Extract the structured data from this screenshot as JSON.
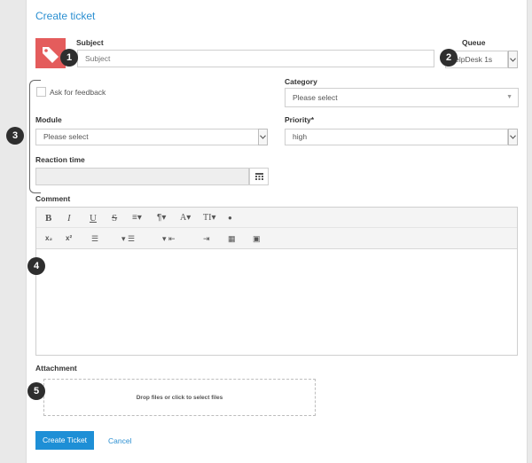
{
  "form": {
    "title": "Create ticket",
    "subject": {
      "label": "Subject",
      "placeholder": "Subject",
      "badge": "1"
    },
    "queue": {
      "label": "Queue",
      "value": "HelpDesk 1s",
      "badge": "2"
    },
    "ask_feedback": {
      "label": "Ask for feedback",
      "checked": false
    },
    "category": {
      "label": "Category",
      "value": "Please select"
    },
    "module": {
      "label": "Module",
      "value": "Please select"
    },
    "priority": {
      "label": "Priority*",
      "value": "high"
    },
    "reaction_time": {
      "label": "Reaction time",
      "value": ""
    },
    "group_badge": "3",
    "comment": {
      "label": "Comment",
      "badge": "4",
      "toolbar_row1": [
        "B",
        "I",
        "U",
        "S",
        "≡▾",
        "¶▾",
        "A▾",
        "TI▾",
        "●"
      ],
      "toolbar_row2": [
        "x₂",
        "x²",
        "☰",
        "▾ ☰",
        "▾ ⇤",
        "⇥",
        "▦",
        "▣"
      ]
    },
    "attachment": {
      "label": "Attachment",
      "drop_text": "Drop files or click to select files",
      "badge": "5"
    },
    "actions": {
      "create": "Create Ticket",
      "cancel": "Cancel"
    }
  },
  "colors": {
    "accent": "#1e8fd6",
    "tag_icon_bg": "#e45c5c",
    "badge_bg": "#2e2e2e"
  },
  "icons": {
    "tag": "tag-icon",
    "calendar": "calendar-icon",
    "chevron": "chevron-down-icon"
  }
}
